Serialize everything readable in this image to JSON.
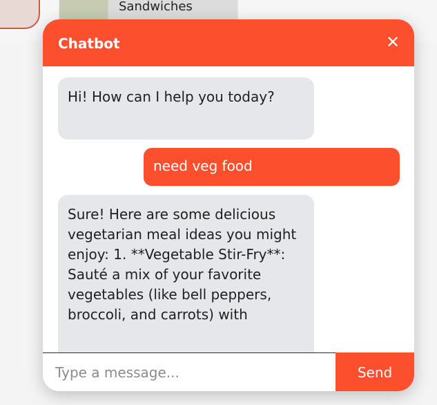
{
  "background": {
    "category_label": "Sandwiches"
  },
  "chatbot": {
    "title": "Chatbot",
    "close_label": "✕",
    "messages": [
      {
        "sender": "bot",
        "text": "Hi! How can I help you today?"
      },
      {
        "sender": "user",
        "text": "need veg food"
      },
      {
        "sender": "bot",
        "text": "Sure! Here are some delicious vegetarian meal ideas you might enjoy: 1. **Vegetable Stir-Fry**: Sauté a mix of your favorite vegetables (like bell peppers, broccoli, and carrots) with"
      }
    ],
    "composer": {
      "placeholder": "Type a message...",
      "value": "",
      "send_label": "Send"
    }
  },
  "colors": {
    "accent": "#fc4f2d",
    "bot_bubble": "#e6e7ea",
    "user_bubble": "#fc4f2d"
  },
  "icons": {
    "close": "close-icon"
  }
}
